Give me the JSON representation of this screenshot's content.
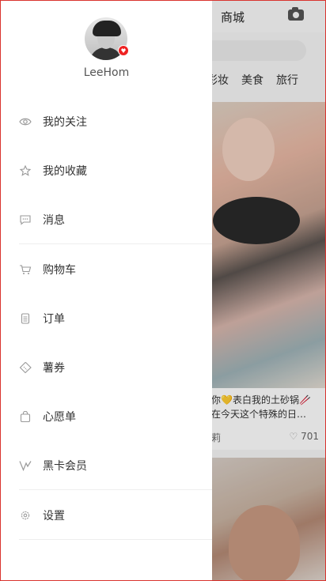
{
  "background": {
    "title": "商城",
    "tabs": [
      "彩妆",
      "美食",
      "旅行"
    ],
    "card1": {
      "caption_line1": "你💛表白我的土砂锅🥢",
      "caption_line2": "在今天这个特殊的日…",
      "author": "莉",
      "likes": "701"
    }
  },
  "drawer": {
    "username": "LeeHom",
    "items": [
      {
        "label": "我的关注",
        "icon": "eye-icon"
      },
      {
        "label": "我的收藏",
        "icon": "star-icon"
      },
      {
        "label": "消息",
        "icon": "message-icon"
      },
      {
        "label": "购物车",
        "icon": "cart-icon"
      },
      {
        "label": "订单",
        "icon": "order-icon"
      },
      {
        "label": "薯券",
        "icon": "coupon-icon"
      },
      {
        "label": "心愿单",
        "icon": "wishlist-icon"
      },
      {
        "label": "黑卡会员",
        "icon": "black-card-icon"
      },
      {
        "label": "设置",
        "icon": "settings-icon"
      }
    ]
  },
  "colors": {
    "frame_border": "#d9332e",
    "badge": "#e22222",
    "icon_gray": "#999999"
  }
}
